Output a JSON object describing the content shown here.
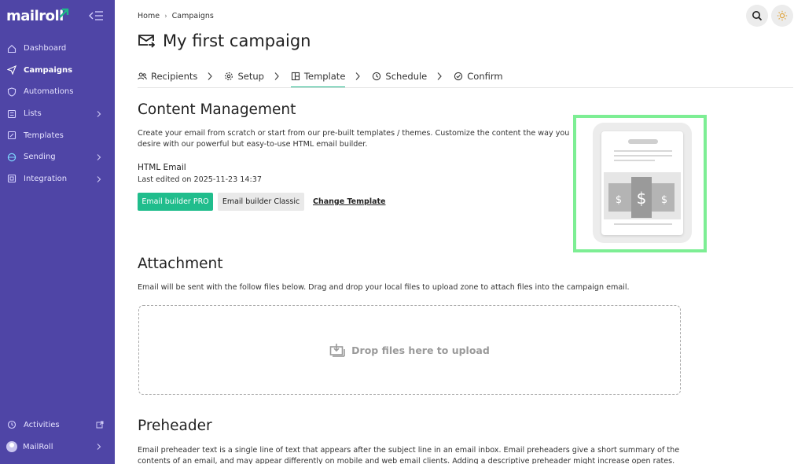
{
  "brand": {
    "logo_text": "mailroll",
    "accent": "#1fb88a",
    "sidebar_bg": "#4f45a6"
  },
  "sidebar": {
    "items": [
      {
        "label": "Dashboard",
        "icon": "home-icon",
        "has_chevron": false
      },
      {
        "label": "Campaigns",
        "icon": "send-icon",
        "has_chevron": false,
        "active": true
      },
      {
        "label": "Automations",
        "icon": "shield-icon",
        "has_chevron": false
      },
      {
        "label": "Lists",
        "icon": "list-icon",
        "has_chevron": true
      },
      {
        "label": "Templates",
        "icon": "edit-icon",
        "has_chevron": false
      },
      {
        "label": "Sending",
        "icon": "globe-icon",
        "has_chevron": true
      },
      {
        "label": "Integration",
        "icon": "plug-icon",
        "has_chevron": true
      }
    ],
    "bottom": {
      "activities_label": "Activities",
      "account_label": "MailRoll"
    }
  },
  "breadcrumb": {
    "home": "Home",
    "separator": "›",
    "current": "Campaigns"
  },
  "page": {
    "title": "My first campaign"
  },
  "tabs": [
    {
      "label": "Recipients",
      "icon": "users-icon"
    },
    {
      "label": "Setup",
      "icon": "gear-icon"
    },
    {
      "label": "Template",
      "icon": "layout-icon",
      "active": true
    },
    {
      "label": "Schedule",
      "icon": "clock-icon"
    },
    {
      "label": "Confirm",
      "icon": "check-circle-icon"
    }
  ],
  "content_management": {
    "title": "Content Management",
    "description_line1": "Create your email from scratch or start from our pre-built templates / themes. Customize the content the way you",
    "description_line2": "desire with our powerful but easy-to-use HTML email builder.",
    "email_type": "HTML Email",
    "last_edited": "Last edited on 2025-11-23 14:37",
    "btn_pro": "Email builder PRO",
    "btn_classic": "Email builder Classic",
    "change_template": "Change Template"
  },
  "attachment": {
    "title": "Attachment",
    "description": "Email will be sent with the follow files below. Drag and drop your local files to upload zone to attach files into the campaign email.",
    "dropzone_text": "Drop files here to upload"
  },
  "preheader": {
    "title": "Preheader",
    "description_line1": "Email preheader text is a single line of text that appears after the subject line in an email inbox. Email preheaders give a short summary of the",
    "description_line2": "contents of an email, and may appear differently on mobile and web email clients. Adding a descriptive preheader might increase open rates."
  }
}
